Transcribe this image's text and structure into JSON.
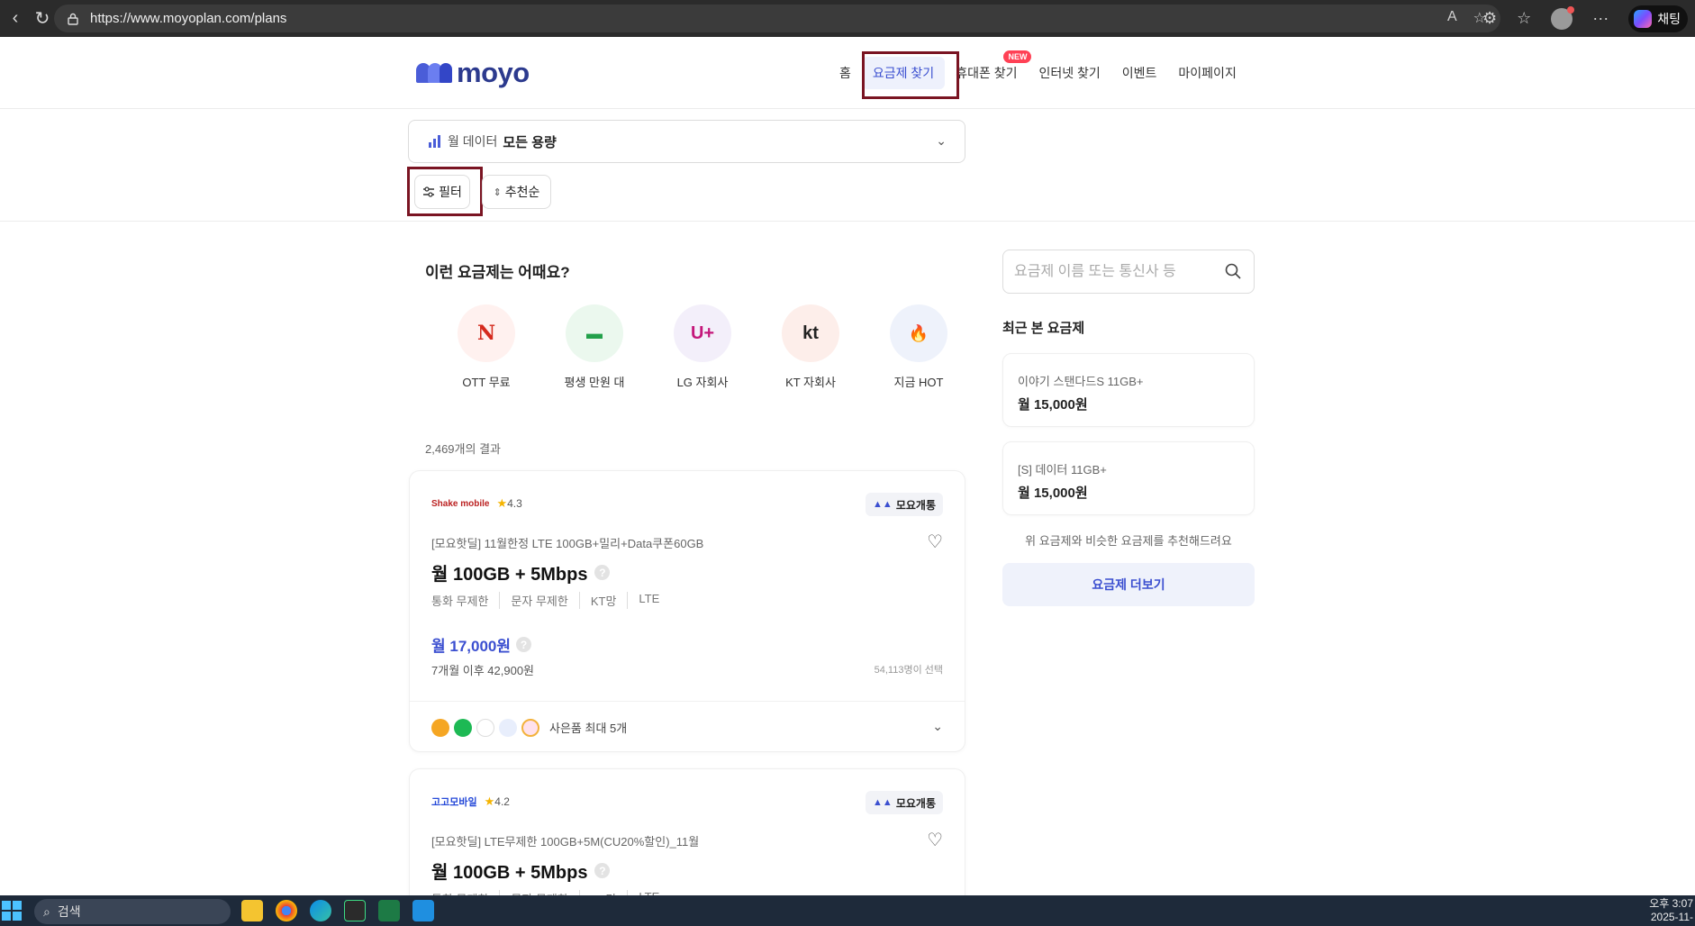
{
  "browser": {
    "url": "https://www.moyoplan.com/plans",
    "profile_label": "채팅"
  },
  "header": {
    "logo_text": "moyo",
    "nav": [
      {
        "label": "홈"
      },
      {
        "label": "요금제 찾기"
      },
      {
        "label": "휴대폰 찾기",
        "badge": "NEW"
      },
      {
        "label": "인터넷 찾기"
      },
      {
        "label": "이벤트"
      },
      {
        "label": "마이페이지"
      }
    ]
  },
  "filters": {
    "data_label": "월 데이터",
    "data_value": "모든 용량",
    "filter_label": "필터",
    "sort_label": "추천순"
  },
  "suggestions": {
    "title": "이런 요금제는 어때요?",
    "items": [
      {
        "label": "OTT 무료",
        "glyph": "N",
        "icon": "netflix-icon"
      },
      {
        "label": "평생 만원 대",
        "glyph": "▬",
        "icon": "cash-icon"
      },
      {
        "label": "LG 자회사",
        "glyph": "U+",
        "icon": "lg-uplus-icon"
      },
      {
        "label": "KT 자회사",
        "glyph": "kt",
        "icon": "kt-icon"
      },
      {
        "label": "지금 HOT",
        "glyph": "🔥",
        "icon": "fire-icon"
      }
    ]
  },
  "results": {
    "count_text": "2,469개의 결과",
    "plans": [
      {
        "carrier_logo": "Shake mobile",
        "rating": "4.3",
        "tag": "모요개통",
        "name": "[모요핫딜] 11월한정 LTE 100GB+밀리+Data쿠폰60GB",
        "title": "월 100GB + 5Mbps",
        "features": [
          "통화 무제한",
          "문자 무제한",
          "KT망",
          "LTE"
        ],
        "price": "월 17,000원",
        "after": "7개월 이후 42,900원",
        "chosen": "54,113명이 선택",
        "gift_label": "사은품 최대 5개"
      },
      {
        "carrier_logo": "고고모바일",
        "rating": "4.2",
        "tag": "모요개통",
        "name": "[모요핫딜] LTE무제한 100GB+5M(CU20%할인)_11월",
        "title": "월 100GB + 5Mbps",
        "features": [
          "통화 무제한",
          "문자 무제한",
          "KT망",
          "LTE"
        ]
      }
    ]
  },
  "sidebar": {
    "search_placeholder": "요금제 이름 또는 통신사 등",
    "recent_title": "최근 본 요금제",
    "recent": [
      {
        "name": "이야기 스탠다드S 11GB+",
        "price": "월 15,000원"
      },
      {
        "name": "[S] 데이터 11GB+",
        "price": "월 15,000원"
      }
    ],
    "recommend_text": "위 요금제와 비슷한 요금제를 추천해드려요",
    "more_label": "요금제 더보기"
  },
  "taskbar": {
    "search_label": "검색",
    "time": "오후 3:07",
    "date": "2025-11-"
  },
  "colors": {
    "accent": "#3b4fd0",
    "highlight_box": "#7a1422"
  }
}
